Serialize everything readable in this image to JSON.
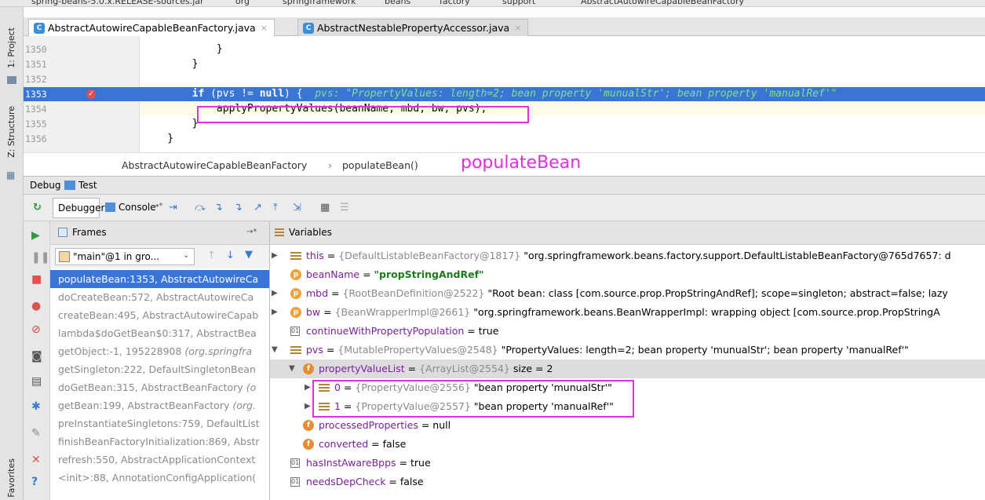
{
  "breadcrumb_top": [
    "spring-beans-5.0.x.RELEASE-sources.jar",
    "org",
    "springframework",
    "beans",
    "factory",
    "support",
    "AbstractAutowireCapableBeanFactory"
  ],
  "sidebar": {
    "project": "1: Project",
    "structure": "Z: Structure",
    "favorites": "Favorites"
  },
  "tabs": [
    {
      "label": "AbstractAutowireCapableBeanFactory.java",
      "icon": "c-class-icon",
      "close": "×"
    },
    {
      "label": "AbstractNestablePropertyAccessor.java",
      "icon": "c-class-icon",
      "close": "×"
    }
  ],
  "editor": {
    "lines": [
      {
        "num": "1350",
        "code": "            }"
      },
      {
        "num": "1351",
        "code": "        }"
      },
      {
        "num": "1352",
        "code": ""
      },
      {
        "num": "1353",
        "code_kw": "if",
        "code_rest": " (pvs != ",
        "code_kw2": "null",
        "code_end": ") {",
        "hint": "pvs: \"PropertyValues: length=2; bean property 'munualStr'; bean property 'manualRef'\""
      },
      {
        "num": "1354",
        "code": "            applyPropertyValues(beanName, mbd, bw, pvs);"
      },
      {
        "num": "1355",
        "code": "        }"
      },
      {
        "num": "1356",
        "code": "    }"
      }
    ],
    "crumb_class": "AbstractAutowireCapableBeanFactory",
    "crumb_sep": "›",
    "crumb_method": "populateBean()",
    "annotation": "populateBean"
  },
  "debug": {
    "title": "Debug",
    "config": "Test",
    "tab_debugger": "Debugger",
    "tab_console": "Console",
    "tab_console_suffix": "→*"
  },
  "frames": {
    "header": "Frames",
    "header_pin": "→*",
    "thread": "\"main\"@1 in gro...",
    "items": [
      {
        "method": "populateBean:1353, AbstractAutowireCa",
        "pkg": ""
      },
      {
        "method": "doCreateBean:572, AbstractAutowireCa",
        "pkg": ""
      },
      {
        "method": "createBean:495, AbstractAutowireCapab",
        "pkg": ""
      },
      {
        "method": "lambda$doGetBean$0:317, AbstractBea",
        "pkg": ""
      },
      {
        "method": "getObject:-1, 195228908 ",
        "pkg": "(org.springfra"
      },
      {
        "method": "getSingleton:222, DefaultSingletonBean",
        "pkg": ""
      },
      {
        "method": "doGetBean:315, AbstractBeanFactory ",
        "pkg": "(o"
      },
      {
        "method": "getBean:199, AbstractBeanFactory ",
        "pkg": "(org."
      },
      {
        "method": "preInstantiateSingletons:759, DefaultList",
        "pkg": ""
      },
      {
        "method": "finishBeanFactoryInitialization:869, Abstr",
        "pkg": ""
      },
      {
        "method": "refresh:550, AbstractApplicationContext",
        "pkg": ""
      },
      {
        "method": "<init>:88, AnnotationConfigApplication(",
        "pkg": ""
      }
    ]
  },
  "variables": {
    "header": "Variables",
    "rows": [
      {
        "name": "this",
        "eq": " = ",
        "type": "{DefaultListableBeanFactory@1817}",
        "val": " \"org.springframework.beans.factory.support.DefaultListableBeanFactory@765d7657: d"
      },
      {
        "name": "beanName",
        "eq": " = ",
        "type": "",
        "val": "\"propStringAndRef\""
      },
      {
        "name": "mbd",
        "eq": " = ",
        "type": "{RootBeanDefinition@2522}",
        "val": " \"Root bean: class [com.source.prop.PropStringAndRef]; scope=singleton; abstract=false; lazy"
      },
      {
        "name": "bw",
        "eq": " = ",
        "type": "{BeanWrapperImpl@2661}",
        "val": " \"org.springframework.beans.BeanWrapperImpl: wrapping object [com.source.prop.PropStringA"
      },
      {
        "name": "continueWithPropertyPopulation",
        "eq": " = ",
        "type": "",
        "val": "true"
      },
      {
        "name": "pvs",
        "eq": " = ",
        "type": "{MutablePropertyValues@2548}",
        "val": " \"PropertyValues: length=2; bean property 'munualStr'; bean property 'manualRef'\""
      },
      {
        "name": "propertyValueList",
        "eq": " = ",
        "type": "{ArrayList@2554}",
        "val": "  size = 2"
      },
      {
        "name": "0",
        "eq": " = ",
        "type": "{PropertyValue@2556}",
        "val": " \"bean property 'munualStr'\""
      },
      {
        "name": "1",
        "eq": " = ",
        "type": "{PropertyValue@2557}",
        "val": " \"bean property 'manualRef'\""
      },
      {
        "name": "processedProperties",
        "eq": " = ",
        "type": "",
        "val": "null"
      },
      {
        "name": "converted",
        "eq": " = ",
        "type": "",
        "val": "false"
      },
      {
        "name": "hasInstAwareBpps",
        "eq": " = ",
        "type": "",
        "val": "true"
      },
      {
        "name": "needsDepCheck",
        "eq": " = ",
        "type": "",
        "val": "false"
      }
    ]
  },
  "colors": {
    "selection": "#3875d7",
    "highlight_box": "#e02ee0",
    "annotation": "#e02ee0",
    "debug_hint": "#3aa850"
  }
}
